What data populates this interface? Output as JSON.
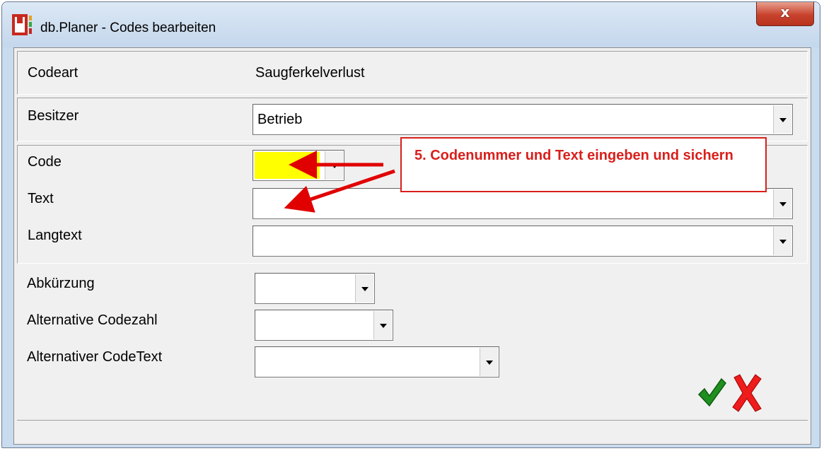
{
  "window": {
    "title": "db.Planer - Codes bearbeiten",
    "close_symbol": "x"
  },
  "codeart": {
    "label": "Codeart",
    "value": "Saugferkelverlust"
  },
  "besitzer": {
    "label": "Besitzer",
    "value": "Betrieb"
  },
  "code": {
    "label": "Code",
    "value": "",
    "field_color": "#ffff00"
  },
  "text": {
    "label": "Text",
    "value": ""
  },
  "langtext": {
    "label": "Langtext",
    "value": ""
  },
  "abkuerzung": {
    "label": "Abkürzung",
    "value": ""
  },
  "alt_codezahl": {
    "label": "Alternative Codezahl",
    "value": ""
  },
  "alt_codetext": {
    "label": "Alternativer CodeText",
    "value": ""
  },
  "callout": {
    "text": "5. Codenummer und Text eingeben und sichern",
    "color": "#d8201c"
  },
  "buttons": {
    "ok_icon": "checkmark-icon",
    "cancel_icon": "x-mark-icon"
  }
}
